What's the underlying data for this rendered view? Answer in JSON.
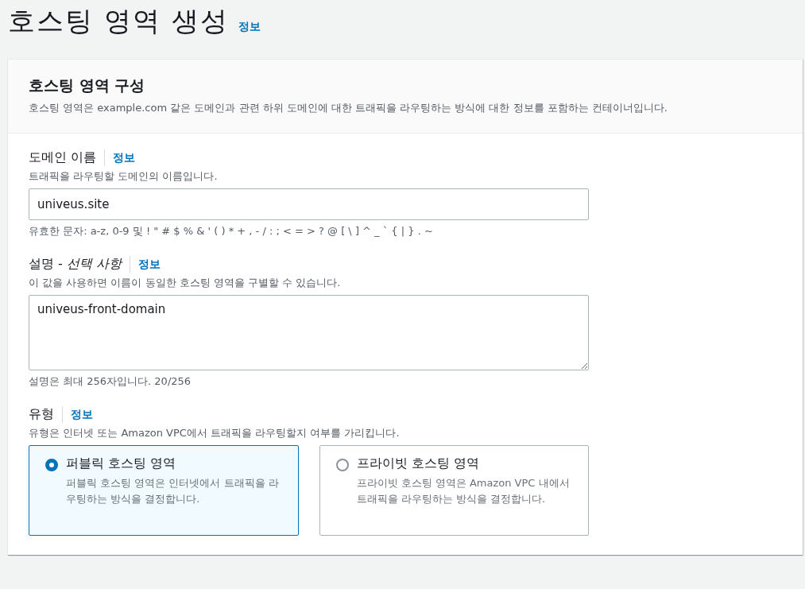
{
  "page": {
    "title": "호스팅 영역 생성",
    "info_link": "정보"
  },
  "panel": {
    "title": "호스팅 영역 구성",
    "description": "호스팅 영역은 example.com 같은 도메인과 관련 하위 도메인에 대한 트래픽을 라우팅하는 방식에 대한 정보를 포함하는 컨테이너입니다."
  },
  "fields": [
    {
      "kind": "input",
      "label": "도메인 이름",
      "info_link": "정보",
      "hint": "트래픽을 라우팅할 도메인의 이름입니다.",
      "value": "univeus.site",
      "constraint": "유효한 문자: a-z, 0-9 및 ! \" # $ % & ' ( ) * + , - / : ; < = > ? @ [ \\ ] ^ _ ` { | } . ~"
    },
    {
      "kind": "textarea",
      "label": "설명 - *선택 사항*",
      "info_link": "정보",
      "hint": "이 값을 사용하면 이름이 동일한 호스팅 영역을 구별할 수 있습니다.",
      "value": "univeus-front-domain",
      "constraint": "설명은 최대 256자입니다. 20/256"
    },
    {
      "kind": "radio",
      "label": "유형",
      "info_link": "정보",
      "hint": "유형은 인터넷 또는 Amazon VPC에서 트래픽을 라우팅할지 여부를 가리킵니다.",
      "options": [
        {
          "label": "퍼블릭 호스팅 영역",
          "description": "퍼블릭 호스팅 영역은 인터넷에서 트래픽을 라우팅하는 방식을 결정합니다.",
          "selected": true
        },
        {
          "label": "프라이빗 호스팅 영역",
          "description": "프라이빗 호스팅 영역은 Amazon VPC 내에서 트래픽을 라우팅하는 방식을 결정합니다.",
          "selected": false
        }
      ]
    }
  ]
}
